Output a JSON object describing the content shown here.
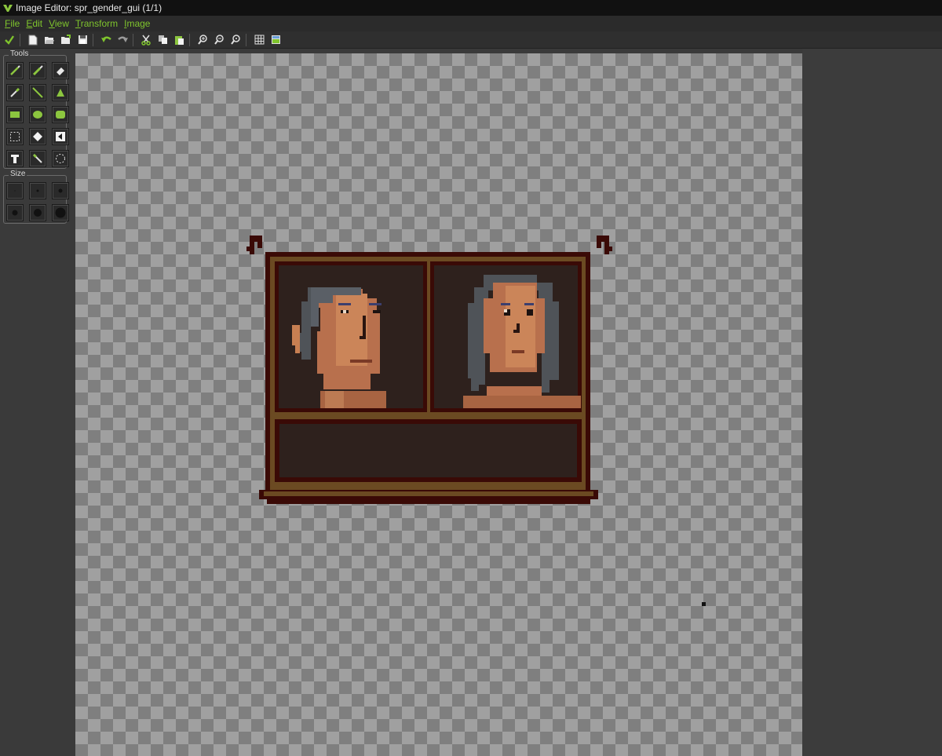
{
  "window": {
    "title": "Image Editor: spr_gender_gui (1/1)"
  },
  "menu": [
    {
      "u": "F",
      "rest": "ile"
    },
    {
      "u": "E",
      "rest": "dit"
    },
    {
      "u": "V",
      "rest": "iew"
    },
    {
      "u": "T",
      "rest": "ransform"
    },
    {
      "u": "I",
      "rest": "mage"
    }
  ],
  "toolbar": {
    "buttons": [
      "confirm-icon",
      "new-icon",
      "open-icon",
      "import-icon",
      "save-icon",
      "undo-icon",
      "redo-icon",
      "cut-icon",
      "copy-icon",
      "paste-icon",
      "zoom-in-icon",
      "zoom-out-icon",
      "zoom-reset-icon",
      "grid-icon",
      "background-icon"
    ]
  },
  "tools_panel": {
    "label": "Tools",
    "tools": [
      "pencil-icon",
      "spray-icon",
      "eraser-icon",
      "color-picker-icon",
      "line-icon",
      "polygon-icon",
      "rectangle-icon",
      "ellipse-icon",
      "rounded-rect-icon",
      "selection-icon",
      "fill-icon",
      "change-color-icon",
      "text-icon",
      "magic-wand-icon",
      "circle-select-icon"
    ]
  },
  "size_panel": {
    "label": "Size",
    "sizes": [
      "size-1",
      "size-2",
      "size-3",
      "size-4",
      "size-5",
      "size-6"
    ]
  },
  "colors": {
    "accent": "#7fc42d",
    "frame_dark": "#3a0a06",
    "frame_brown": "#6b4a22",
    "panel_bg": "#2e211d"
  }
}
